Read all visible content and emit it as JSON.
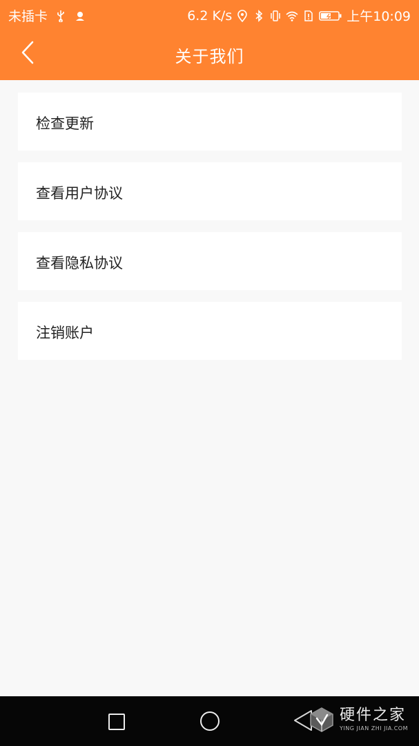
{
  "status_bar": {
    "carrier": "未插卡",
    "speed": "6.2 K/s",
    "time": "上午10:09",
    "icons": [
      "usb-icon",
      "app-notification-icon",
      "location-icon",
      "bluetooth-icon",
      "vibrate-icon",
      "wifi-icon",
      "sim-alert-icon",
      "battery-charging-icon"
    ]
  },
  "header": {
    "title": "关于我们",
    "back_icon": "chevron-left-icon"
  },
  "menu": {
    "items": [
      {
        "label": "检查更新"
      },
      {
        "label": "查看用户协议"
      },
      {
        "label": "查看隐私协议"
      },
      {
        "label": "注销账户"
      }
    ]
  },
  "nav_bar": {
    "buttons": [
      "recents-square-icon",
      "home-circle-icon",
      "back-triangle-icon"
    ]
  },
  "watermark": {
    "title": "硬件之家",
    "subtitle": "YING JIAN ZHI JIA.COM"
  },
  "colors": {
    "accent": "#ff8330",
    "background": "#f8f8f8",
    "card": "#ffffff",
    "text": "#222222",
    "nav_bar": "#060606"
  }
}
